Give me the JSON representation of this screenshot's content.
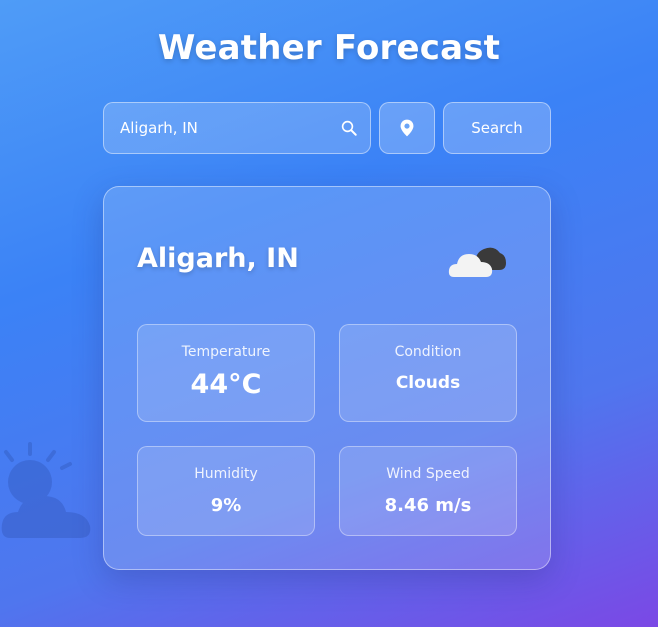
{
  "header": {
    "title": "Weather Forecast"
  },
  "search": {
    "value": "Aligarh, IN",
    "button_label": "Search"
  },
  "icons": {
    "search": "search-icon",
    "location": "location-pin-icon",
    "weather": "cloud-icon",
    "decoration": "sun-cloud-icon"
  },
  "card": {
    "city": "Aligarh, IN",
    "stats": [
      {
        "label": "Temperature",
        "value": "44°C"
      },
      {
        "label": "Condition",
        "value": "Clouds"
      },
      {
        "label": "Humidity",
        "value": "9%"
      },
      {
        "label": "Wind Speed",
        "value": "8.46 m/s"
      }
    ]
  },
  "colors": {
    "bg_top": "#4f9cf7",
    "bg_mid": "#3b82f6",
    "bg_bottom": "#7b48e5"
  }
}
